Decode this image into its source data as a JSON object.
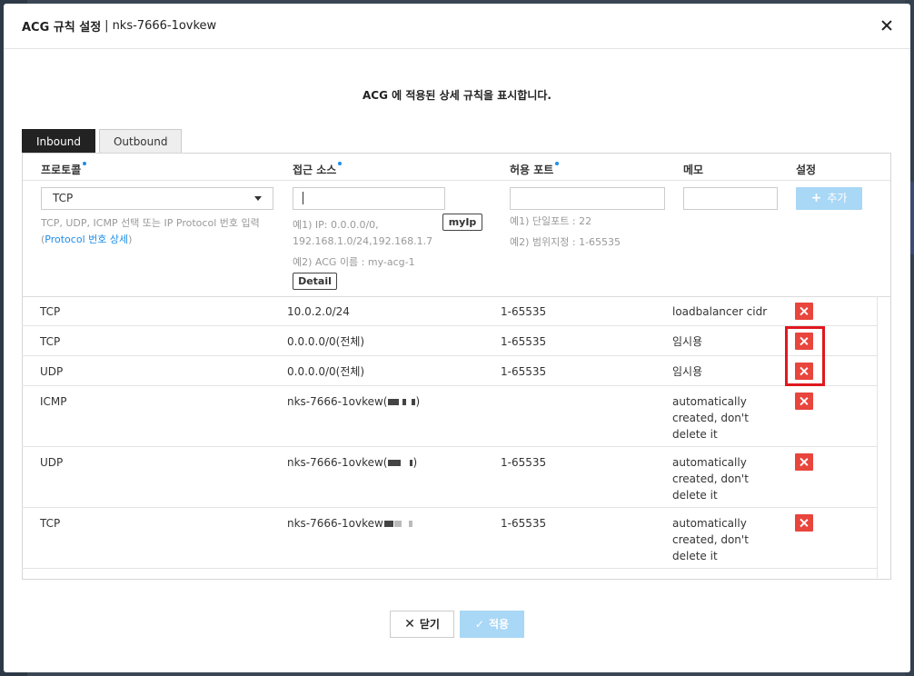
{
  "modal": {
    "title": "ACG 규칙 설정",
    "separator": "|",
    "subtitle": "nks-7666-1ovkew",
    "description": "ACG 에 적용된 상세 규칙을 표시합니다."
  },
  "tabs": [
    {
      "label": "Inbound",
      "active": true
    },
    {
      "label": "Outbound",
      "active": false
    }
  ],
  "columns": {
    "protocol": "프로토콜",
    "source": "접근 소스",
    "port": "허용 포트",
    "memo": "메모",
    "setting": "설정"
  },
  "form": {
    "protocol_value": "TCP",
    "protocol_hint": "TCP, UDP, ICMP 선택 또는 IP Protocol 번호 입력",
    "protocol_link_open": "(",
    "protocol_link": "Protocol 번호 상세",
    "protocol_link_close": ")",
    "source_value": "",
    "myip_label": "myIp",
    "source_hint1a": "예1) IP: 0.0.0.0/0,",
    "source_hint1b": "192.168.1.0/24,192.168.1.7",
    "source_hint2": "예2) ACG 이름 : my-acg-1",
    "detail_label": "Detail",
    "port_hint1": "예1) 단일포트 : 22",
    "port_hint2": "예2) 범위지정 : 1-65535",
    "add_label": "추가"
  },
  "rules": [
    {
      "protocol": "TCP",
      "source": "10.0.2.0/24",
      "port": "1-65535",
      "memo": "loadbalancer cidr"
    },
    {
      "protocol": "TCP",
      "source": "0.0.0.0/0(전체)",
      "port": "1-65535",
      "memo": "임시용"
    },
    {
      "protocol": "UDP",
      "source": "0.0.0.0/0(전체)",
      "port": "1-65535",
      "memo": "임시용"
    },
    {
      "protocol": "ICMP",
      "source": "nks-7666-1ovkew(",
      "port": "",
      "memo": "automatically created, don't delete it"
    },
    {
      "protocol": "UDP",
      "source": "nks-7666-1ovkew(",
      "port": "1-65535",
      "memo": "automatically created, don't delete it"
    },
    {
      "protocol": "TCP",
      "source": "nks-7666-1ovkew",
      "port": "1-65535",
      "memo": "automatically created, don't delete it"
    }
  ],
  "footer": {
    "close_label": "닫기",
    "apply_label": "적용"
  },
  "colors": {
    "accent": "#1e8ee9",
    "delete": "#e8453c",
    "highlight": "#e0181f",
    "disabled_button": "#a9d7f6"
  }
}
